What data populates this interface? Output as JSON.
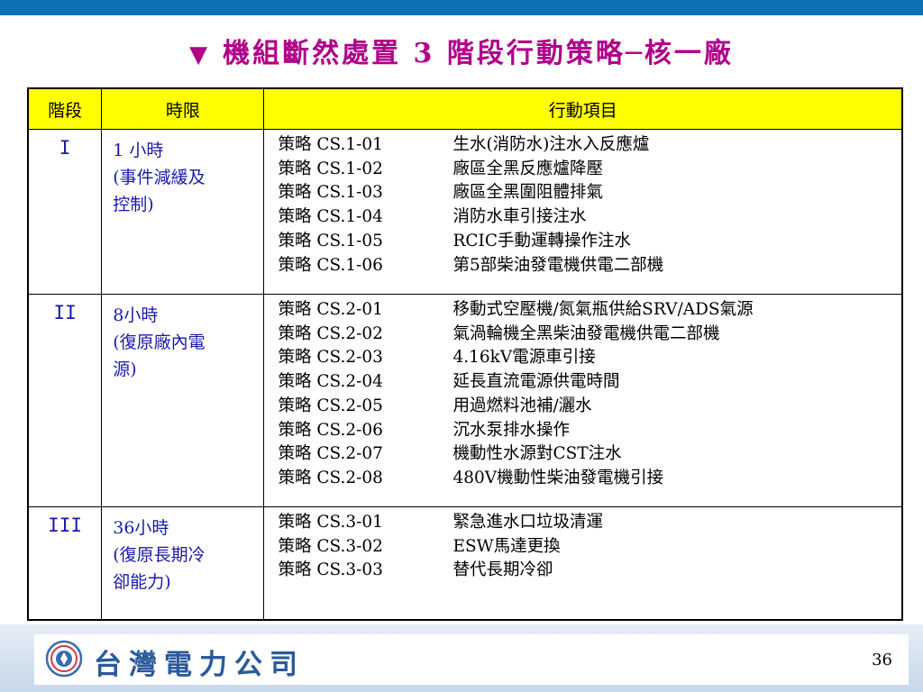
{
  "title": "機組斷然處置 3 階段行動策略─核一廠",
  "title_marker": "▼",
  "table": {
    "headers": [
      "階段",
      "時限",
      "行動項目"
    ],
    "rows": [
      {
        "stage": "I",
        "period_line1": "1 小時",
        "period_line2": "(事件減緩及",
        "period_line3": "控制)",
        "items": [
          {
            "code": "策略 CS.1-01",
            "action": "生水(消防水)注水入反應爐"
          },
          {
            "code": "策略 CS.1-02",
            "action": "廠區全黑反應爐降壓"
          },
          {
            "code": "策略 CS.1-03",
            "action": "廠區全黑圍阻體排氣"
          },
          {
            "code": "策略 CS.1-04",
            "action": "消防水車引接注水"
          },
          {
            "code": "策略 CS.1-05",
            "action": "RCIC手動運轉操作注水"
          },
          {
            "code": "策略 CS.1-06",
            "action": "第5部柴油發電機供電二部機"
          }
        ]
      },
      {
        "stage": "II",
        "period_line1": "8小時",
        "period_line2": "(復原廠內電",
        "period_line3": "源)",
        "items": [
          {
            "code": "策略 CS.2-01",
            "action": "移動式空壓機/氮氣瓶供給SRV/ADS氣源"
          },
          {
            "code": "策略 CS.2-02",
            "action": "氣渦輪機全黑柴油發電機供電二部機"
          },
          {
            "code": "策略 CS.2-03",
            "action": "4.16kV電源車引接"
          },
          {
            "code": "策略 CS.2-04",
            "action": "延長直流電源供電時間"
          },
          {
            "code": "策略 CS.2-05",
            "action": "用過燃料池補/灑水"
          },
          {
            "code": "策略 CS.2-06",
            "action": "沉水泵排水操作"
          },
          {
            "code": "策略 CS.2-07",
            "action": "機動性水源對CST注水"
          },
          {
            "code": "策略 CS.2-08",
            "action": "480V機動性柴油發電機引接"
          }
        ]
      },
      {
        "stage": "III",
        "period_line1": "36小時",
        "period_line2": "(復原長期冷",
        "period_line3": "卻能力)",
        "items": [
          {
            "code": "策略 CS.3-01",
            "action": "緊急進水口垃圾清運"
          },
          {
            "code": "策略 CS.3-02",
            "action": "ESW馬達更換"
          },
          {
            "code": "策略 CS.3-03",
            "action": "替代長期冷卻"
          }
        ]
      }
    ]
  },
  "footer": {
    "company": "台灣電力公司",
    "page_number": "36"
  },
  "colors": {
    "accent_bar": "#0d6fb4",
    "title": "#b0008a",
    "header_fill": "#ffff00",
    "stage_text": "#1a1aa8"
  }
}
